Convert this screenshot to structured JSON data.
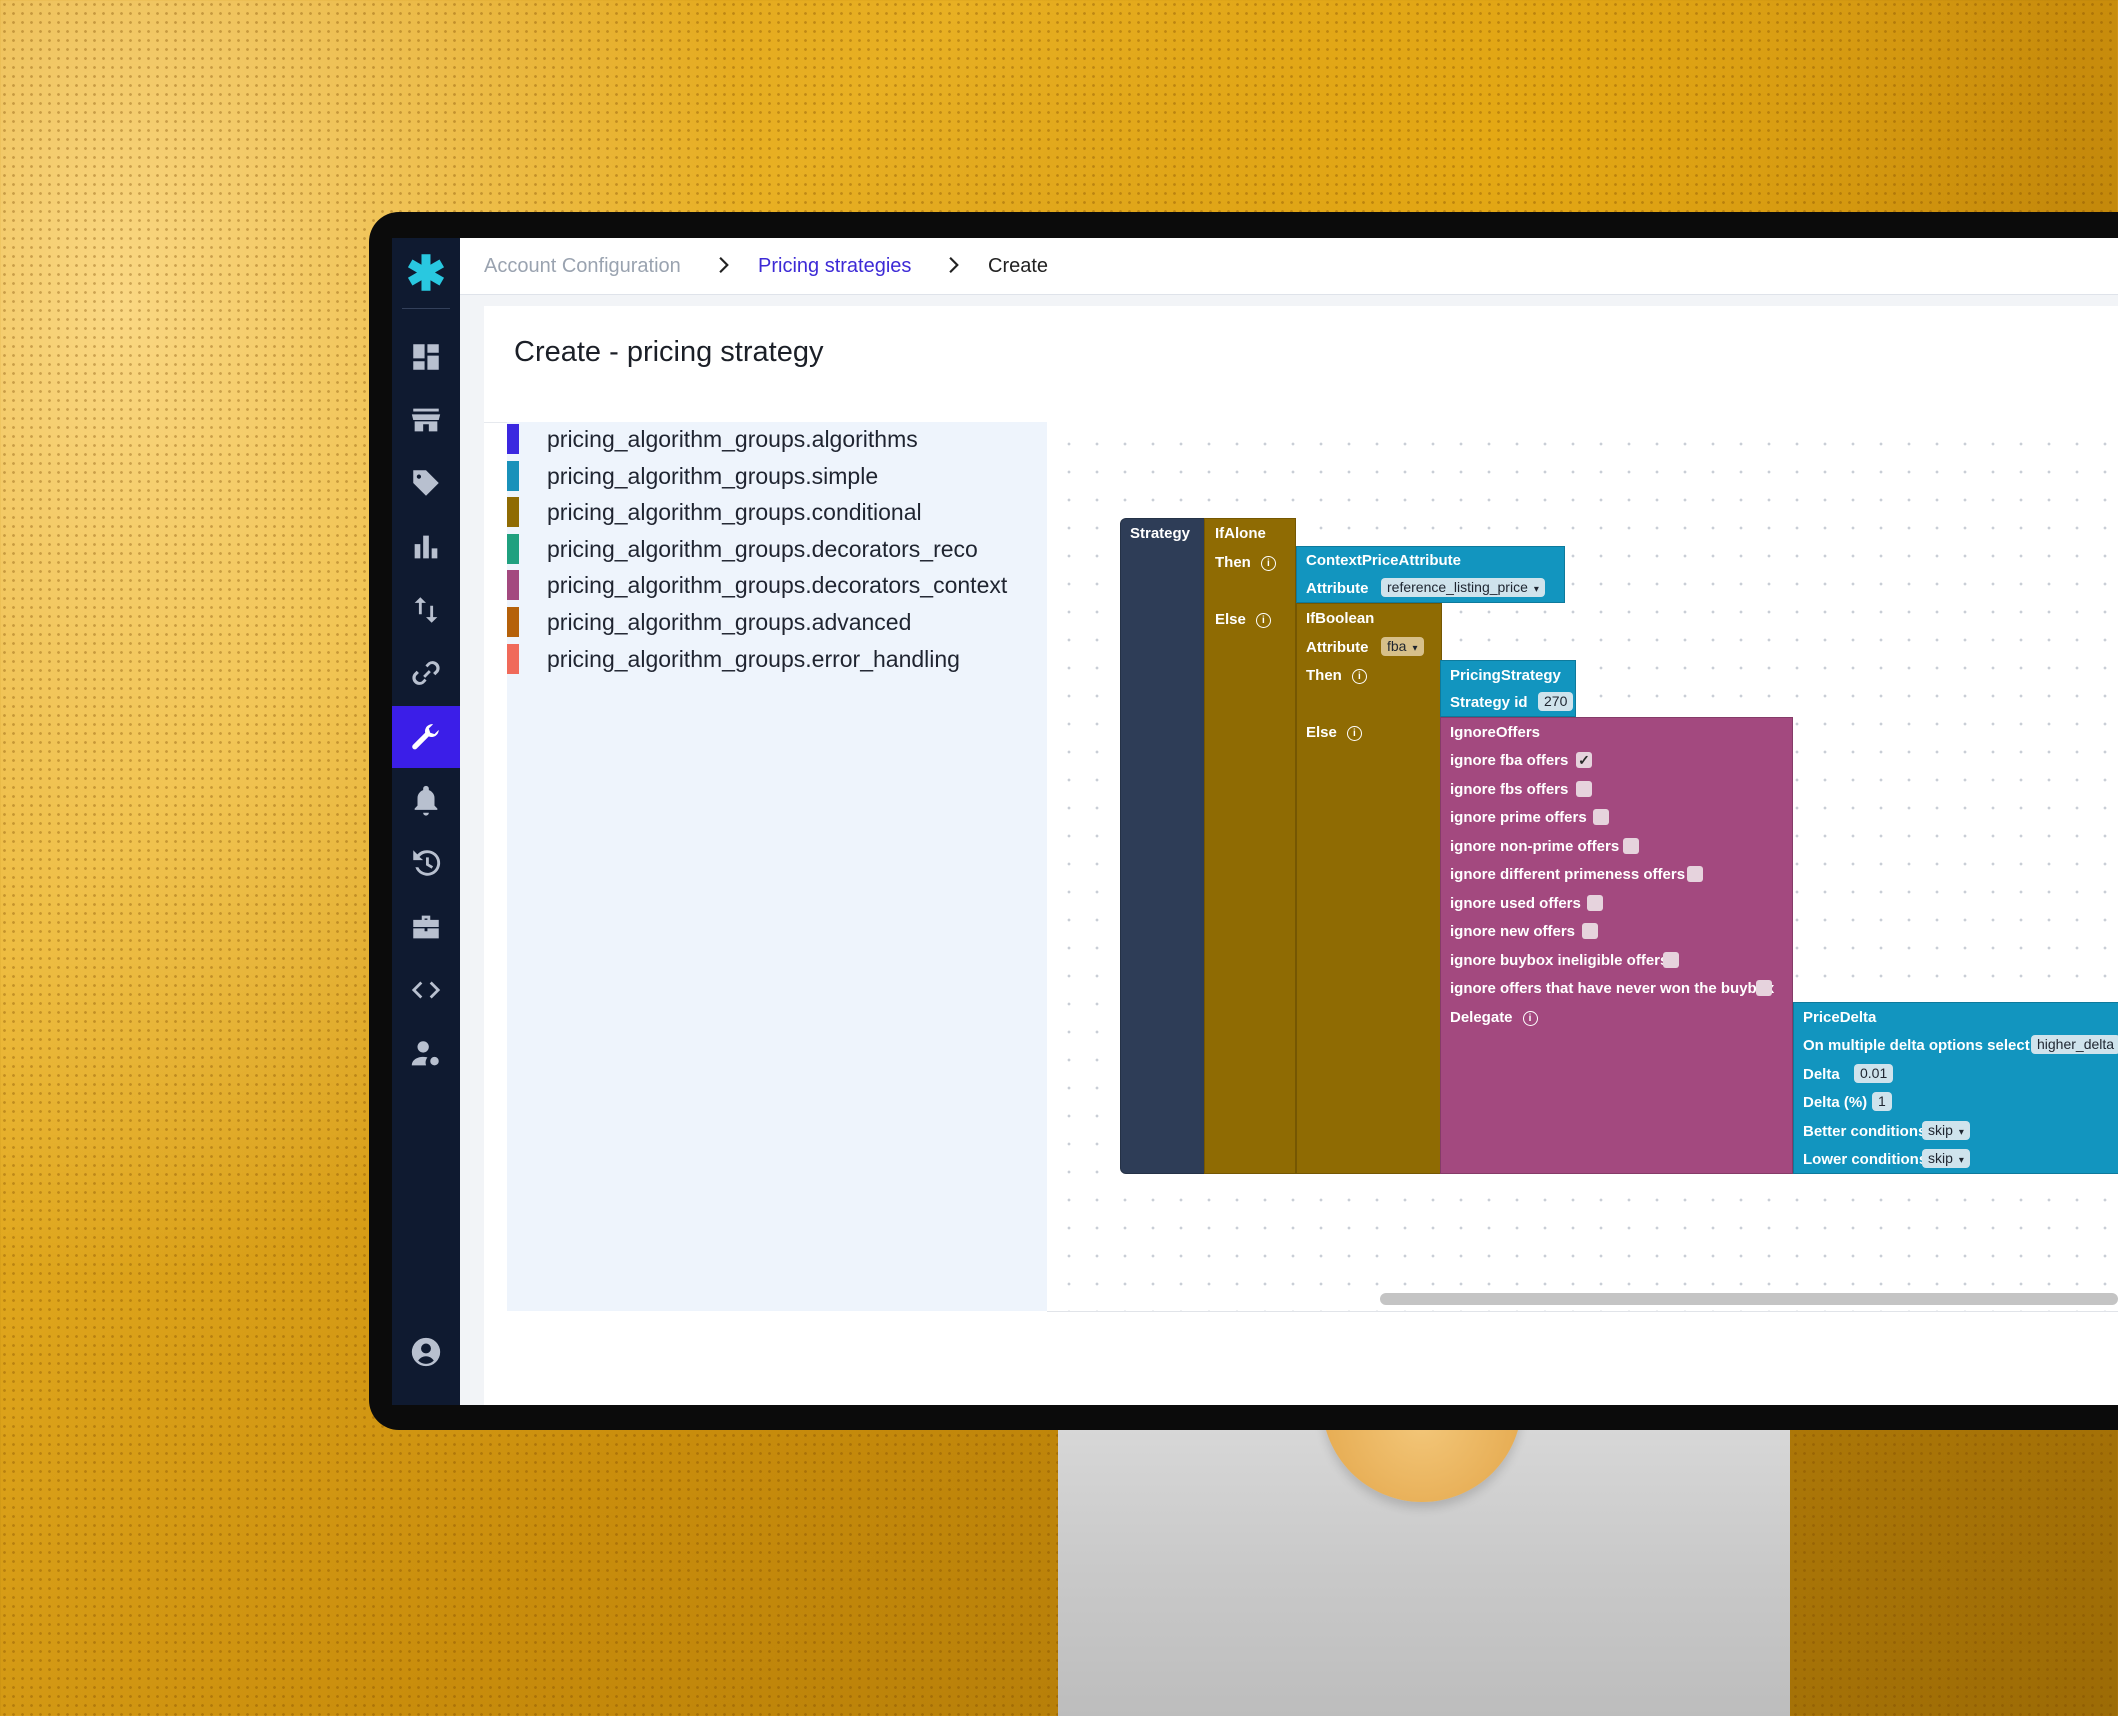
{
  "breadcrumb": {
    "items": [
      "Account Configuration",
      "Pricing strategies",
      "Create"
    ]
  },
  "page": {
    "title": "Create - pricing strategy"
  },
  "colors": {
    "sidebar": "#0f1a30",
    "accent": "#3b1ee8",
    "logo": "#29c8e0",
    "navy_block": "#2e3d57",
    "olive_block": "#8f6b03",
    "teal_block": "#1295bf",
    "magenta_block": "#a3497f"
  },
  "sidebar": {
    "icons": [
      "asterisk-logo-icon",
      "dashboard-icon",
      "store-icon",
      "tag-icon",
      "bar-chart-icon",
      "swap-vertical-icon",
      "link-icon",
      "wrench-icon",
      "bell-icon",
      "history-icon",
      "toolbox-icon",
      "code-icon",
      "user-settings-icon",
      "account-circle-icon"
    ],
    "active": "wrench-icon"
  },
  "toolbox": {
    "categories": [
      {
        "label": "pricing_algorithm_groups.algorithms",
        "color": "#3b28e0"
      },
      {
        "label": "pricing_algorithm_groups.simple",
        "color": "#1991ba"
      },
      {
        "label": "pricing_algorithm_groups.conditional",
        "color": "#8f6b03"
      },
      {
        "label": "pricing_algorithm_groups.decorators_reco",
        "color": "#1fa07f"
      },
      {
        "label": "pricing_algorithm_groups.decorators_context",
        "color": "#a3497f"
      },
      {
        "label": "pricing_algorithm_groups.advanced",
        "color": "#b5610a"
      },
      {
        "label": "pricing_algorithm_groups.error_handling",
        "color": "#f06a5a"
      }
    ]
  },
  "blocks": {
    "strategy": {
      "label": "Strategy"
    },
    "if_alone": {
      "title": "IfAlone",
      "then": "Then",
      "else": "Else"
    },
    "context_price": {
      "title": "ContextPriceAttribute",
      "attr_label": "Attribute",
      "attr_value": "reference_listing_price"
    },
    "if_boolean": {
      "title": "IfBoolean",
      "attr_label": "Attribute",
      "attr_value": "fba",
      "then": "Then",
      "else": "Else"
    },
    "pricing_strategy": {
      "title": "PricingStrategy",
      "id_label": "Strategy id",
      "id_value": "270"
    },
    "ignore_offers": {
      "title": "IgnoreOffers",
      "options": [
        {
          "label": "ignore fba offers",
          "checked": true
        },
        {
          "label": "ignore fbs offers",
          "checked": false
        },
        {
          "label": "ignore prime offers",
          "checked": false
        },
        {
          "label": "ignore non-prime offers",
          "checked": false
        },
        {
          "label": "ignore different primeness offers",
          "checked": false
        },
        {
          "label": "ignore used offers",
          "checked": false
        },
        {
          "label": "ignore new offers",
          "checked": false
        },
        {
          "label": "ignore buybox ineligible offers",
          "checked": false
        },
        {
          "label": "ignore offers that have never won the buybox",
          "checked": false
        }
      ],
      "delegate": "Delegate"
    },
    "price_delta": {
      "title": "PriceDelta",
      "multi_label": "On multiple delta options select",
      "multi_value": "higher_delta",
      "delta_label": "Delta",
      "delta_value": "0.01",
      "delta_pct_label": "Delta (%)",
      "delta_pct_value": "1",
      "better_label": "Better conditions",
      "better_value": "skip",
      "lower_label": "Lower conditions",
      "lower_value": "skip"
    }
  }
}
